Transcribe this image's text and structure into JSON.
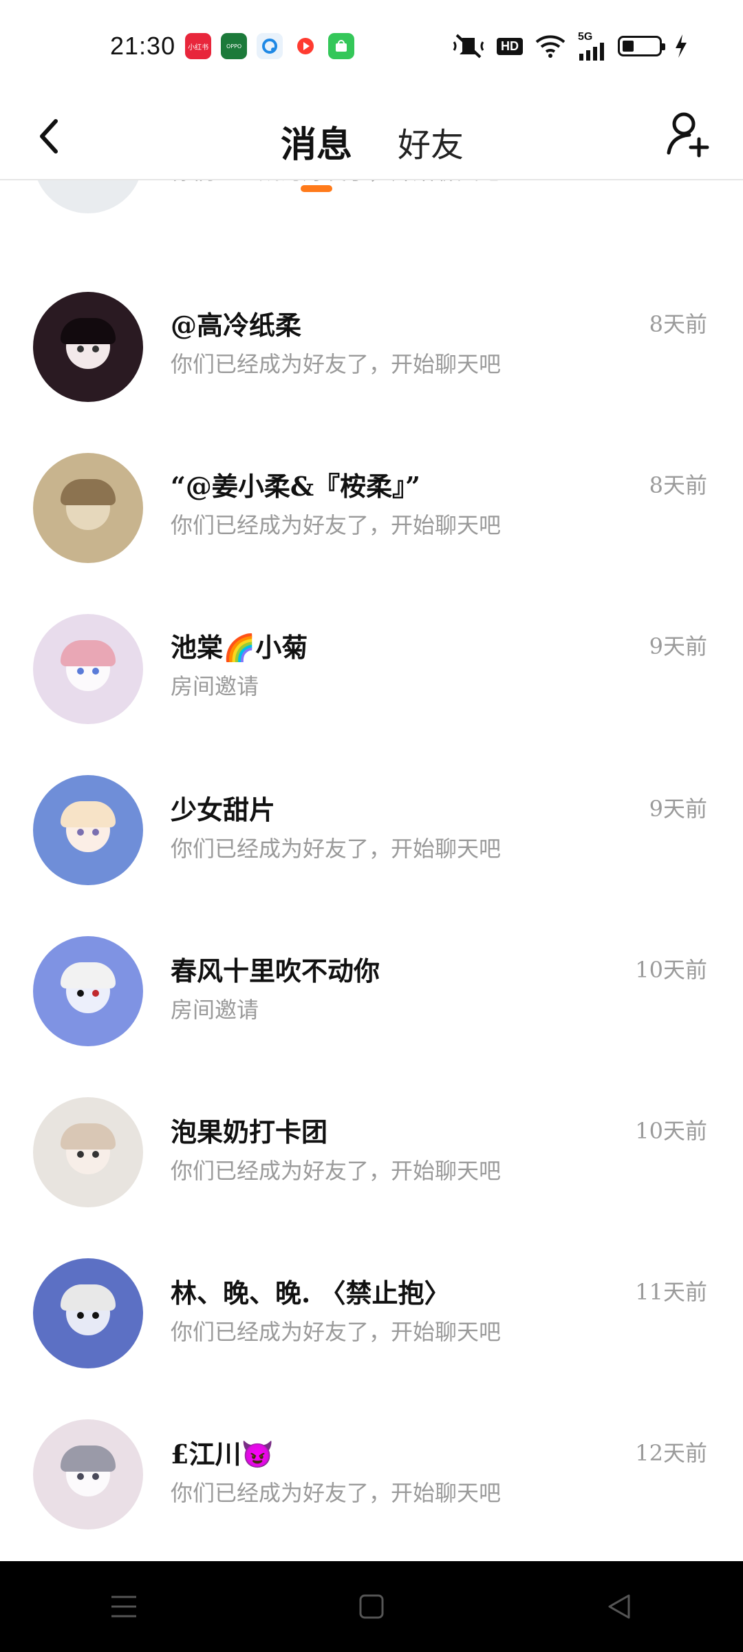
{
  "status_bar": {
    "time": "21:30",
    "apps": [
      {
        "name": "xiaohongshu-icon",
        "label": "小红书",
        "color": "#e8263b"
      },
      {
        "name": "oppo-icon",
        "label": "OPPO",
        "color": "#1c7a3a"
      },
      {
        "name": "q-app-icon",
        "label": "",
        "color": "#e9f2fb"
      },
      {
        "name": "video-app-icon",
        "label": "",
        "color": "#ff3b30"
      },
      {
        "name": "store-app-icon",
        "label": "",
        "color": "#34c759"
      }
    ],
    "hd": "HD",
    "network": "5G"
  },
  "header": {
    "tabs": [
      {
        "label": "消息",
        "active": true
      },
      {
        "label": "好友",
        "active": false
      }
    ],
    "accent": "#ff7a1a"
  },
  "conversations": [
    {
      "name": "",
      "message": "你们已经成为好友了，开始聊天吧",
      "time": "",
      "avatar_bg": "#e9ecef",
      "hair": "#6b4a3a",
      "partial": true
    },
    {
      "name": "@高冷纸柔",
      "message": "你们已经成为好友了，开始聊天吧",
      "time": "8天前",
      "avatar_bg": "#2a1a22",
      "hair": "#120a0e"
    },
    {
      "name": "“@姜小柔&『桉柔』”",
      "message": "你们已经成为好友了，开始聊天吧",
      "time": "8天前",
      "avatar_bg": "#c8b48e",
      "hair": "#8c7350"
    },
    {
      "name": "池棠🌈小菊",
      "message": "房间邀请",
      "time": "9天前",
      "avatar_bg": "#e8dcec",
      "hair": "#e9a7b5"
    },
    {
      "name": "少女甜片",
      "message": "你们已经成为好友了，开始聊天吧",
      "time": "9天前",
      "avatar_bg": "#6f8ed8",
      "hair": "#f7e3c7"
    },
    {
      "name": "春风十里吹不动你",
      "message": "房间邀请",
      "time": "10天前",
      "avatar_bg": "#7f93e3",
      "hair": "#f2f2f2"
    },
    {
      "name": "泡果奶打卡团",
      "message": "你们已经成为好友了，开始聊天吧",
      "time": "10天前",
      "avatar_bg": "#e8e4df",
      "hair": "#d9c7b5"
    },
    {
      "name": "林、晚、晚. 〈禁止抱〉",
      "message": "你们已经成为好友了，开始聊天吧",
      "time": "11天前",
      "avatar_bg": "#5c70c4",
      "hair": "#e8e8e8"
    },
    {
      "name": "£江川😈",
      "message": "你们已经成为好友了，开始聊天吧",
      "time": "12天前",
      "avatar_bg": "#eadfe6",
      "hair": "#9a9aa8"
    }
  ]
}
